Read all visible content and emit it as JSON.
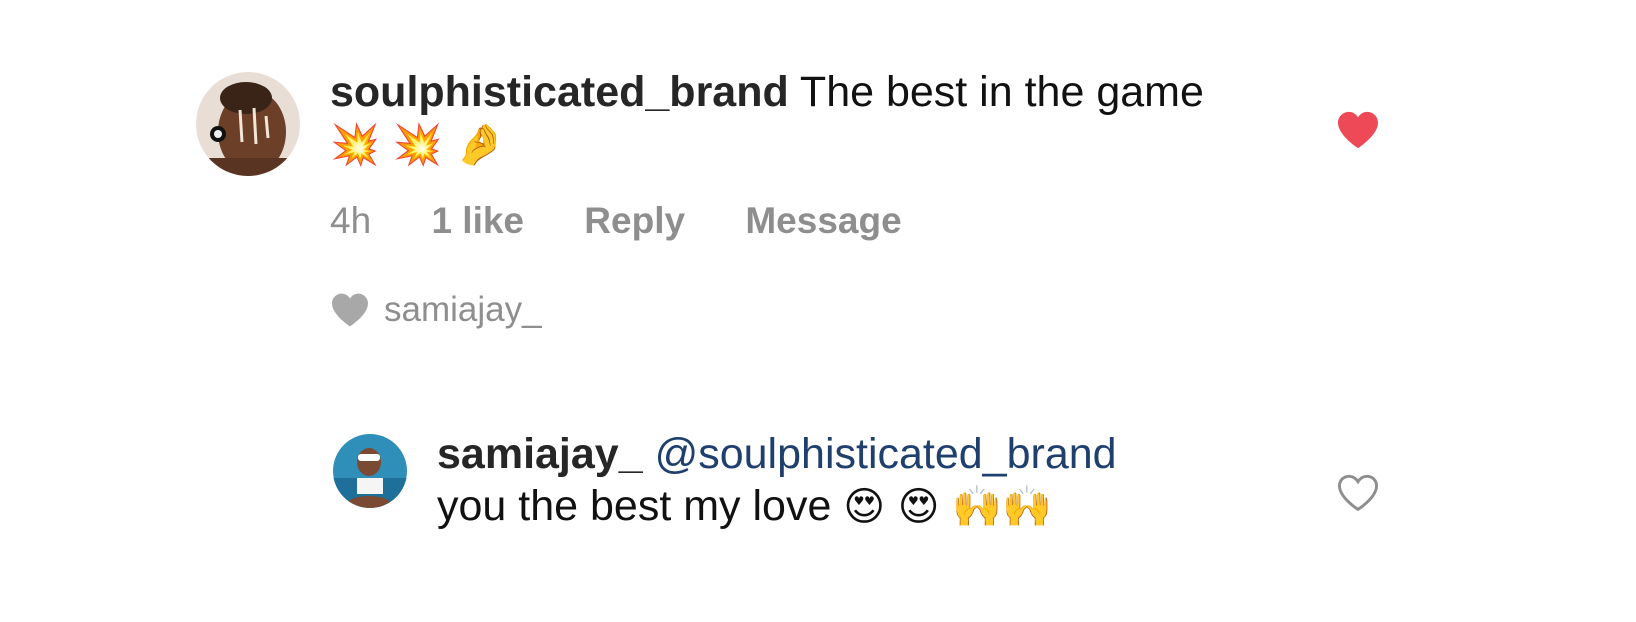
{
  "comment": {
    "username": "soulphisticated_brand",
    "text": "The best in the game",
    "emojis": "💥 💥 🤌",
    "liked": true,
    "heart_color": "#ed4956",
    "meta": {
      "time": "4h",
      "likes": "1 like",
      "reply": "Reply",
      "message": "Message"
    },
    "liked_by": "samiajay_"
  },
  "reply": {
    "username": "samiajay_",
    "mention": "@soulphisticated_brand",
    "text": "you the best my love",
    "emojis": "😍 😍 🙌🙌",
    "liked": false
  },
  "colors": {
    "meta_gray": "#8e8e8e",
    "mention_blue": "#1f3f6e"
  }
}
